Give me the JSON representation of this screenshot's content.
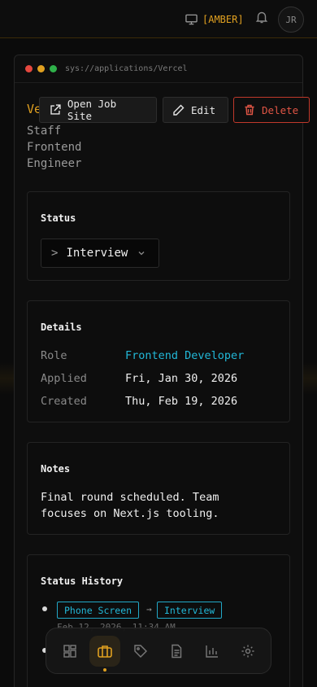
{
  "topbar": {
    "theme_label": "[AMBER]",
    "avatar_initials": "JR"
  },
  "window": {
    "path": "sys://applications/Vercel",
    "dots": [
      "#e5483f",
      "#e0a020",
      "#2fb14a"
    ]
  },
  "application": {
    "company": "Vercel",
    "title_lines": [
      "Staff",
      "Frontend",
      "Engineer"
    ]
  },
  "actions": {
    "open_job_site": "Open Job Site",
    "edit": "Edit",
    "delete": "Delete"
  },
  "status": {
    "title": "Status",
    "prompt": ">",
    "current": "Interview"
  },
  "details": {
    "title": "Details",
    "rows": [
      {
        "label": "Role",
        "value": "Frontend Developer"
      },
      {
        "label": "Applied",
        "value": "Fri, Jan 30, 2026"
      },
      {
        "label": "Created",
        "value": "Thu, Feb 19, 2026"
      }
    ]
  },
  "notes": {
    "title": "Notes",
    "text": "Final round scheduled. Team focuses on Next.js tooling."
  },
  "history": {
    "title": "Status History",
    "entries": [
      {
        "from": "Phone Screen",
        "arrow": "→",
        "to": "Interview",
        "time": "Feb 12, 2026, 11:34 AM"
      }
    ]
  },
  "bottom_nav": {
    "items": [
      "dashboard-icon",
      "briefcase-icon",
      "tag-icon",
      "document-icon",
      "chart-icon",
      "settings-icon"
    ],
    "active": "briefcase-icon"
  },
  "colors": {
    "accent": "#e0a020",
    "link": "#22b8d8",
    "danger": "#e05545"
  }
}
